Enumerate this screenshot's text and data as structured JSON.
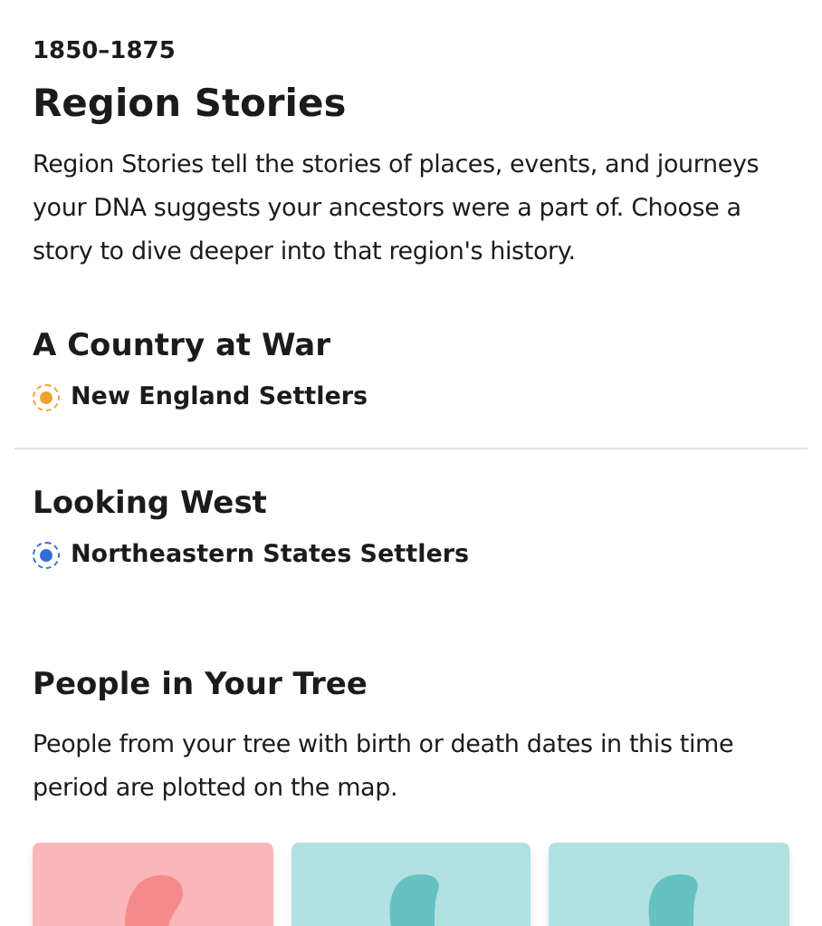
{
  "period": "1850–1875",
  "title": "Region Stories",
  "intro": "Region Stories tell the stories of places, events, and journeys your DNA suggests your ancestors were a part of. Choose a story to dive deeper into that region's history.",
  "stories": [
    {
      "heading": "A Country at War",
      "region": "New England Settlers",
      "color": "#f0a033"
    },
    {
      "heading": "Looking West",
      "region": "Northeastern States Settlers",
      "color": "#2f6fdc"
    }
  ],
  "people": {
    "heading": "People in Your Tree",
    "text": "People from your tree with birth or death dates in this time period are plotted on the map.",
    "cards": [
      {
        "kind": "female"
      },
      {
        "kind": "male"
      },
      {
        "kind": "male"
      }
    ]
  }
}
